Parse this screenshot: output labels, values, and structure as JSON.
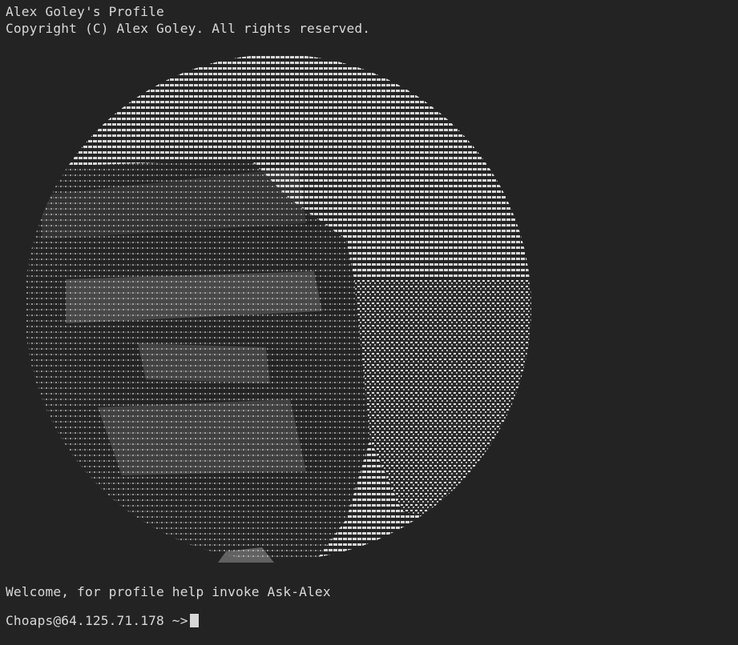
{
  "terminal": {
    "title_line": "Alex Goley's Profile",
    "copyright_line": "Copyright (C) Alex Goley. All rights reserved.",
    "welcome_line": "Welcome, for profile help invoke Ask-Alex",
    "prompt": "Choaps@64.125.71.178 ~>",
    "input_value": ""
  },
  "colors": {
    "background": "#232323",
    "foreground": "#d8d8d8",
    "cursor": "#d8d8d8"
  },
  "portrait": {
    "icon": "ascii-portrait-icon"
  }
}
